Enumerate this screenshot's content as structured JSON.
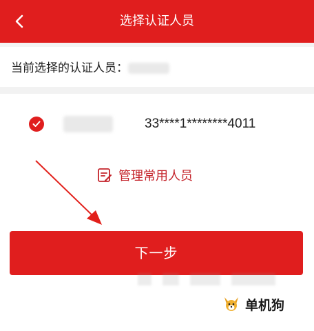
{
  "header": {
    "title": "选择认证人员",
    "back_icon": "back-arrow-icon"
  },
  "current": {
    "label": "当前选择的认证人员："
  },
  "person": {
    "id_number": "33****1********4011"
  },
  "manage": {
    "label": "管理常用人员",
    "icon": "edit-list-icon"
  },
  "next_button": {
    "label": "下一步"
  },
  "watermark": {
    "text": "单机狗"
  },
  "colors": {
    "primary": "#e01e1e",
    "manage_text": "#c4232a"
  }
}
